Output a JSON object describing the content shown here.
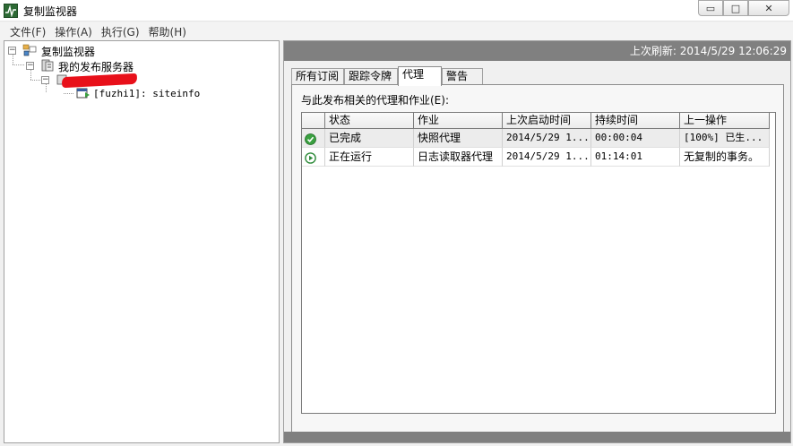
{
  "window": {
    "title": "复制监视器",
    "minimize_glyph": "▭",
    "maximize_glyph": "□",
    "close_glyph": "✕"
  },
  "menu": [
    "文件(F)",
    "操作(A)",
    "执行(G)",
    "帮助(H)"
  ],
  "tree": {
    "root": "复制监视器",
    "publishers": "我的发布服务器",
    "publication": "[fuzhi1]: siteinfo"
  },
  "refresh": "上次刷新: 2014/5/29 12:06:29",
  "tabs": [
    "所有订阅",
    "跟踪令牌",
    "代理",
    "警告"
  ],
  "active_tab": "代理",
  "agents": {
    "section_label": "与此发布相关的代理和作业(E):",
    "columns": [
      "状态",
      "作业",
      "上次启动时间",
      "持续时间",
      "上一操作"
    ],
    "rows": [
      {
        "status_icon": "check-circle-icon",
        "status": "已完成",
        "job": "快照代理",
        "last_start": "2014/5/29 1...",
        "duration": "00:00:04",
        "last_action": "[100%] 已生..."
      },
      {
        "status_icon": "play-circle-icon",
        "status": "正在运行",
        "job": "日志读取器代理",
        "last_start": "2014/5/29 1...",
        "duration": "01:14:01",
        "last_action": "无复制的事务。"
      }
    ]
  },
  "colors": {
    "header_gray": "#808080",
    "check_green": "#3aa040",
    "play_green": "#2e8b3a",
    "redaction": "#e8101a"
  }
}
